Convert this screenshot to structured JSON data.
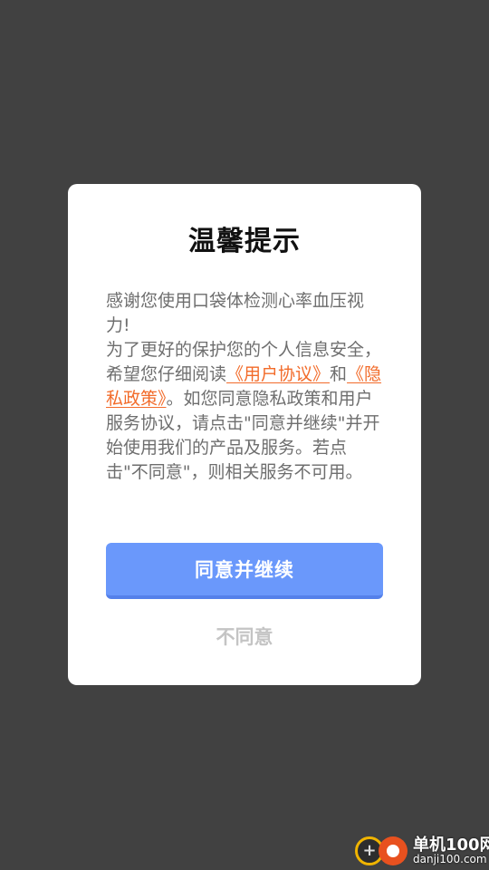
{
  "dialog": {
    "title": "温馨提示",
    "message": {
      "part1": "感谢您使用口袋体检测心率血压视力!",
      "part2": "为了更好的保护您的个人信息安全，希望您仔细阅读",
      "user_agreement_link": "《用户协议》",
      "and": "和",
      "privacy_policy_link": "《隐私政策》",
      "part3": "。如您同意隐私政策和用户服务协议，请点击\"同意并继续\"并开始使用我们的产品及服务。若点击\"不同意\"，则相关服务不可用。"
    },
    "agree_button": "同意并继续",
    "disagree_button": "不同意"
  },
  "watermark": {
    "name": "单机100网",
    "url": "danji100.com"
  },
  "colors": {
    "overlay_background": "#414141",
    "dialog_background": "#ffffff",
    "primary_button": "#6a98fb",
    "link": "#f26b2a",
    "body_text": "#6e6e6e",
    "disabled_text": "#c4c4c4"
  }
}
